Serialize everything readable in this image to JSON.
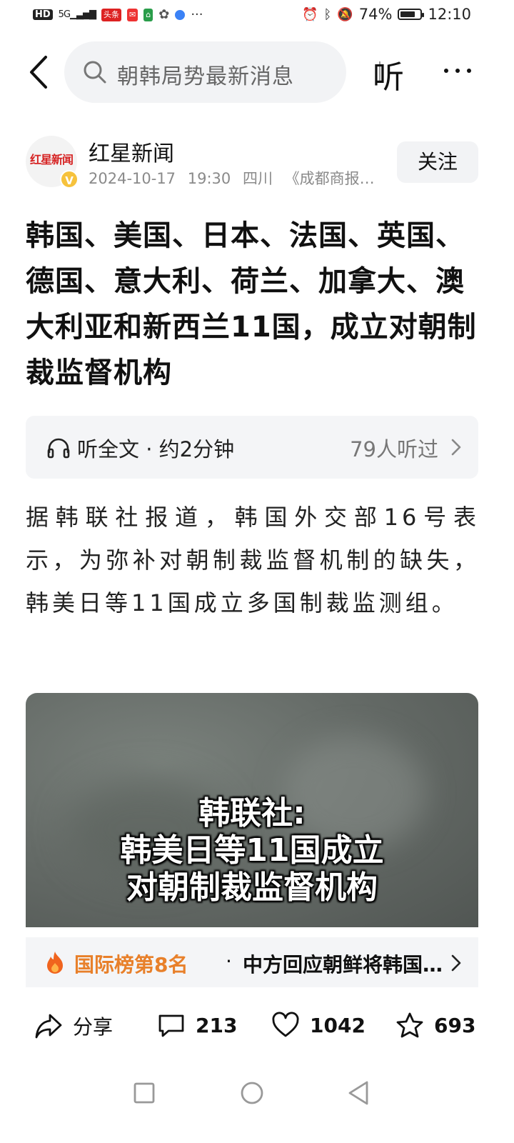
{
  "status_bar": {
    "left_items": [
      "HD",
      "5G",
      "头条"
    ],
    "battery": "74%",
    "time": "12:10"
  },
  "top_bar": {
    "search_text": "朝韩局势最新消息",
    "listen_label": "听"
  },
  "author": {
    "avatar_text": "红星新闻",
    "verified_mark": "V",
    "name": "红星新闻",
    "date": "2024-10-17",
    "time": "19:30",
    "location": "四川",
    "source": "《成都商报…",
    "follow_label": "关注"
  },
  "article": {
    "title": "韩国、美国、日本、法国、英国、德国、意大利、荷兰、加拿大、澳大利亚和新西兰11国，成立对朝制裁监督机构",
    "listen_card": {
      "label": "听全文 · 约2分钟",
      "count": "79人听过"
    },
    "body": "据韩联社报道，韩国外交部16号表示，为弥补对朝制裁监督机制的缺失，韩美日等11国成立多国制裁监测组。",
    "video_caption": [
      "韩联社:",
      "韩美日等11国成立",
      "对朝制裁监督机构"
    ]
  },
  "hot_rank": {
    "rank_label": "国际榜第8名",
    "separator": "·",
    "headline": "中方回应朝鲜将韩国定为敌对国家"
  },
  "actions": {
    "share_label": "分享",
    "comments": "213",
    "likes": "1042",
    "favorites": "693"
  },
  "colors": {
    "accent_orange": "#e8802a",
    "brand_red": "#d62424",
    "verified_yellow": "#f6c23c"
  }
}
